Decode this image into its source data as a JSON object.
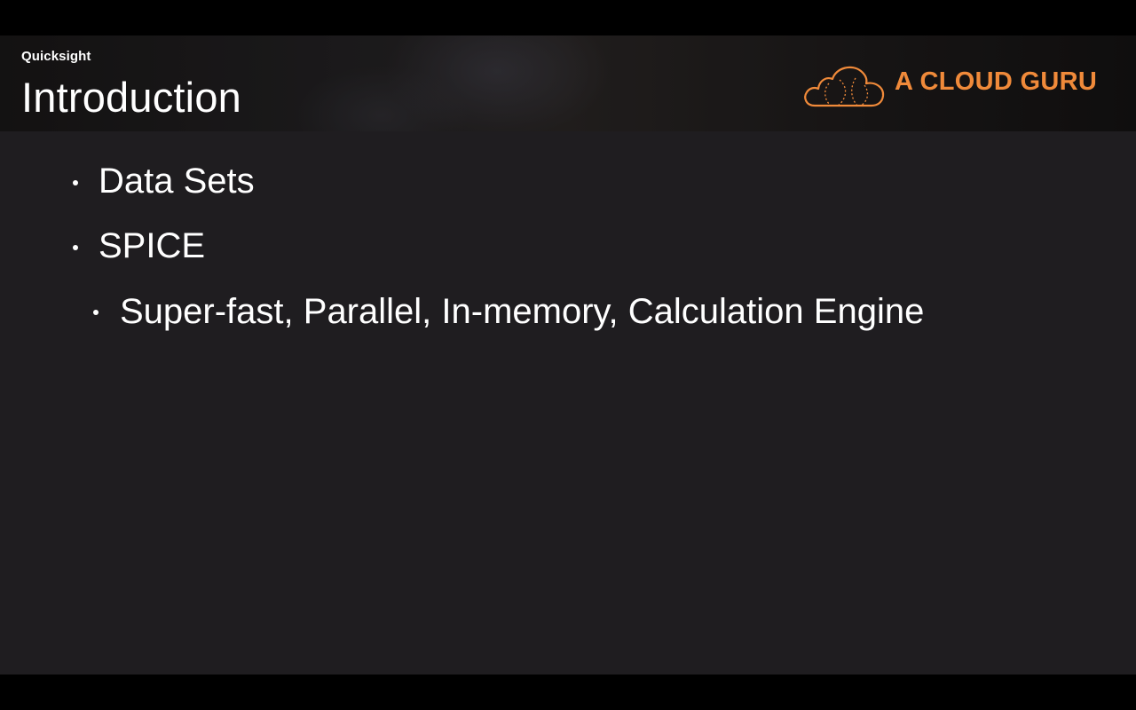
{
  "slide": {
    "subtitle": "Quicksight",
    "title": "Introduction",
    "logo": {
      "icon": "cloud-logo-icon",
      "text": "A CLOUD GURU",
      "color": "#f08a3a"
    },
    "bullets": [
      {
        "level": 1,
        "text": "Data Sets"
      },
      {
        "level": 1,
        "text": "SPICE"
      },
      {
        "level": 2,
        "text": "Super-fast, Parallel, In-memory, Calculation Engine"
      }
    ]
  }
}
